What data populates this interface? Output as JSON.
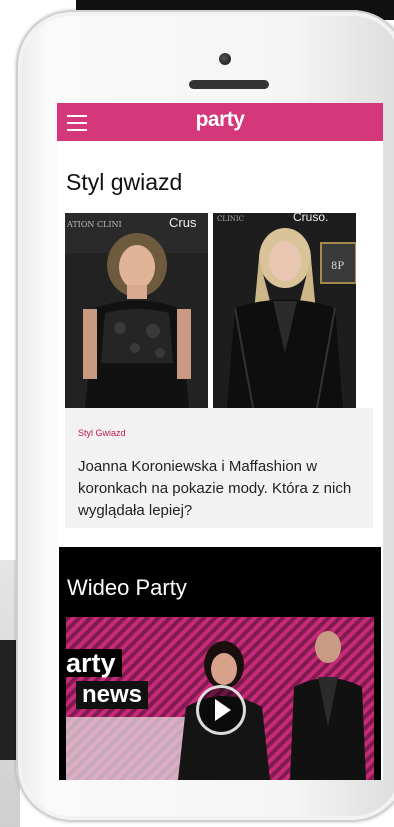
{
  "header": {
    "logo": "party",
    "menu_icon": "hamburger-menu-icon",
    "brand_color": "#d4377a"
  },
  "section": {
    "title": "Styl gwiazd"
  },
  "article": {
    "category": "Styl Gwiazd",
    "title": "Joanna Koroniewska i Maffashion w koronkach na pokazie mody. Która z nich wyglądała lepiej?",
    "accent": "#c2185b"
  },
  "photos": {
    "left_backdrop_text": "ATION CLINI     Crus",
    "right_backdrop_text": "CLINIC     Cruso."
  },
  "video": {
    "section_title": "Wideo Party",
    "brand_line1": "arty",
    "brand_line2": "news",
    "play_icon": "play-icon"
  }
}
